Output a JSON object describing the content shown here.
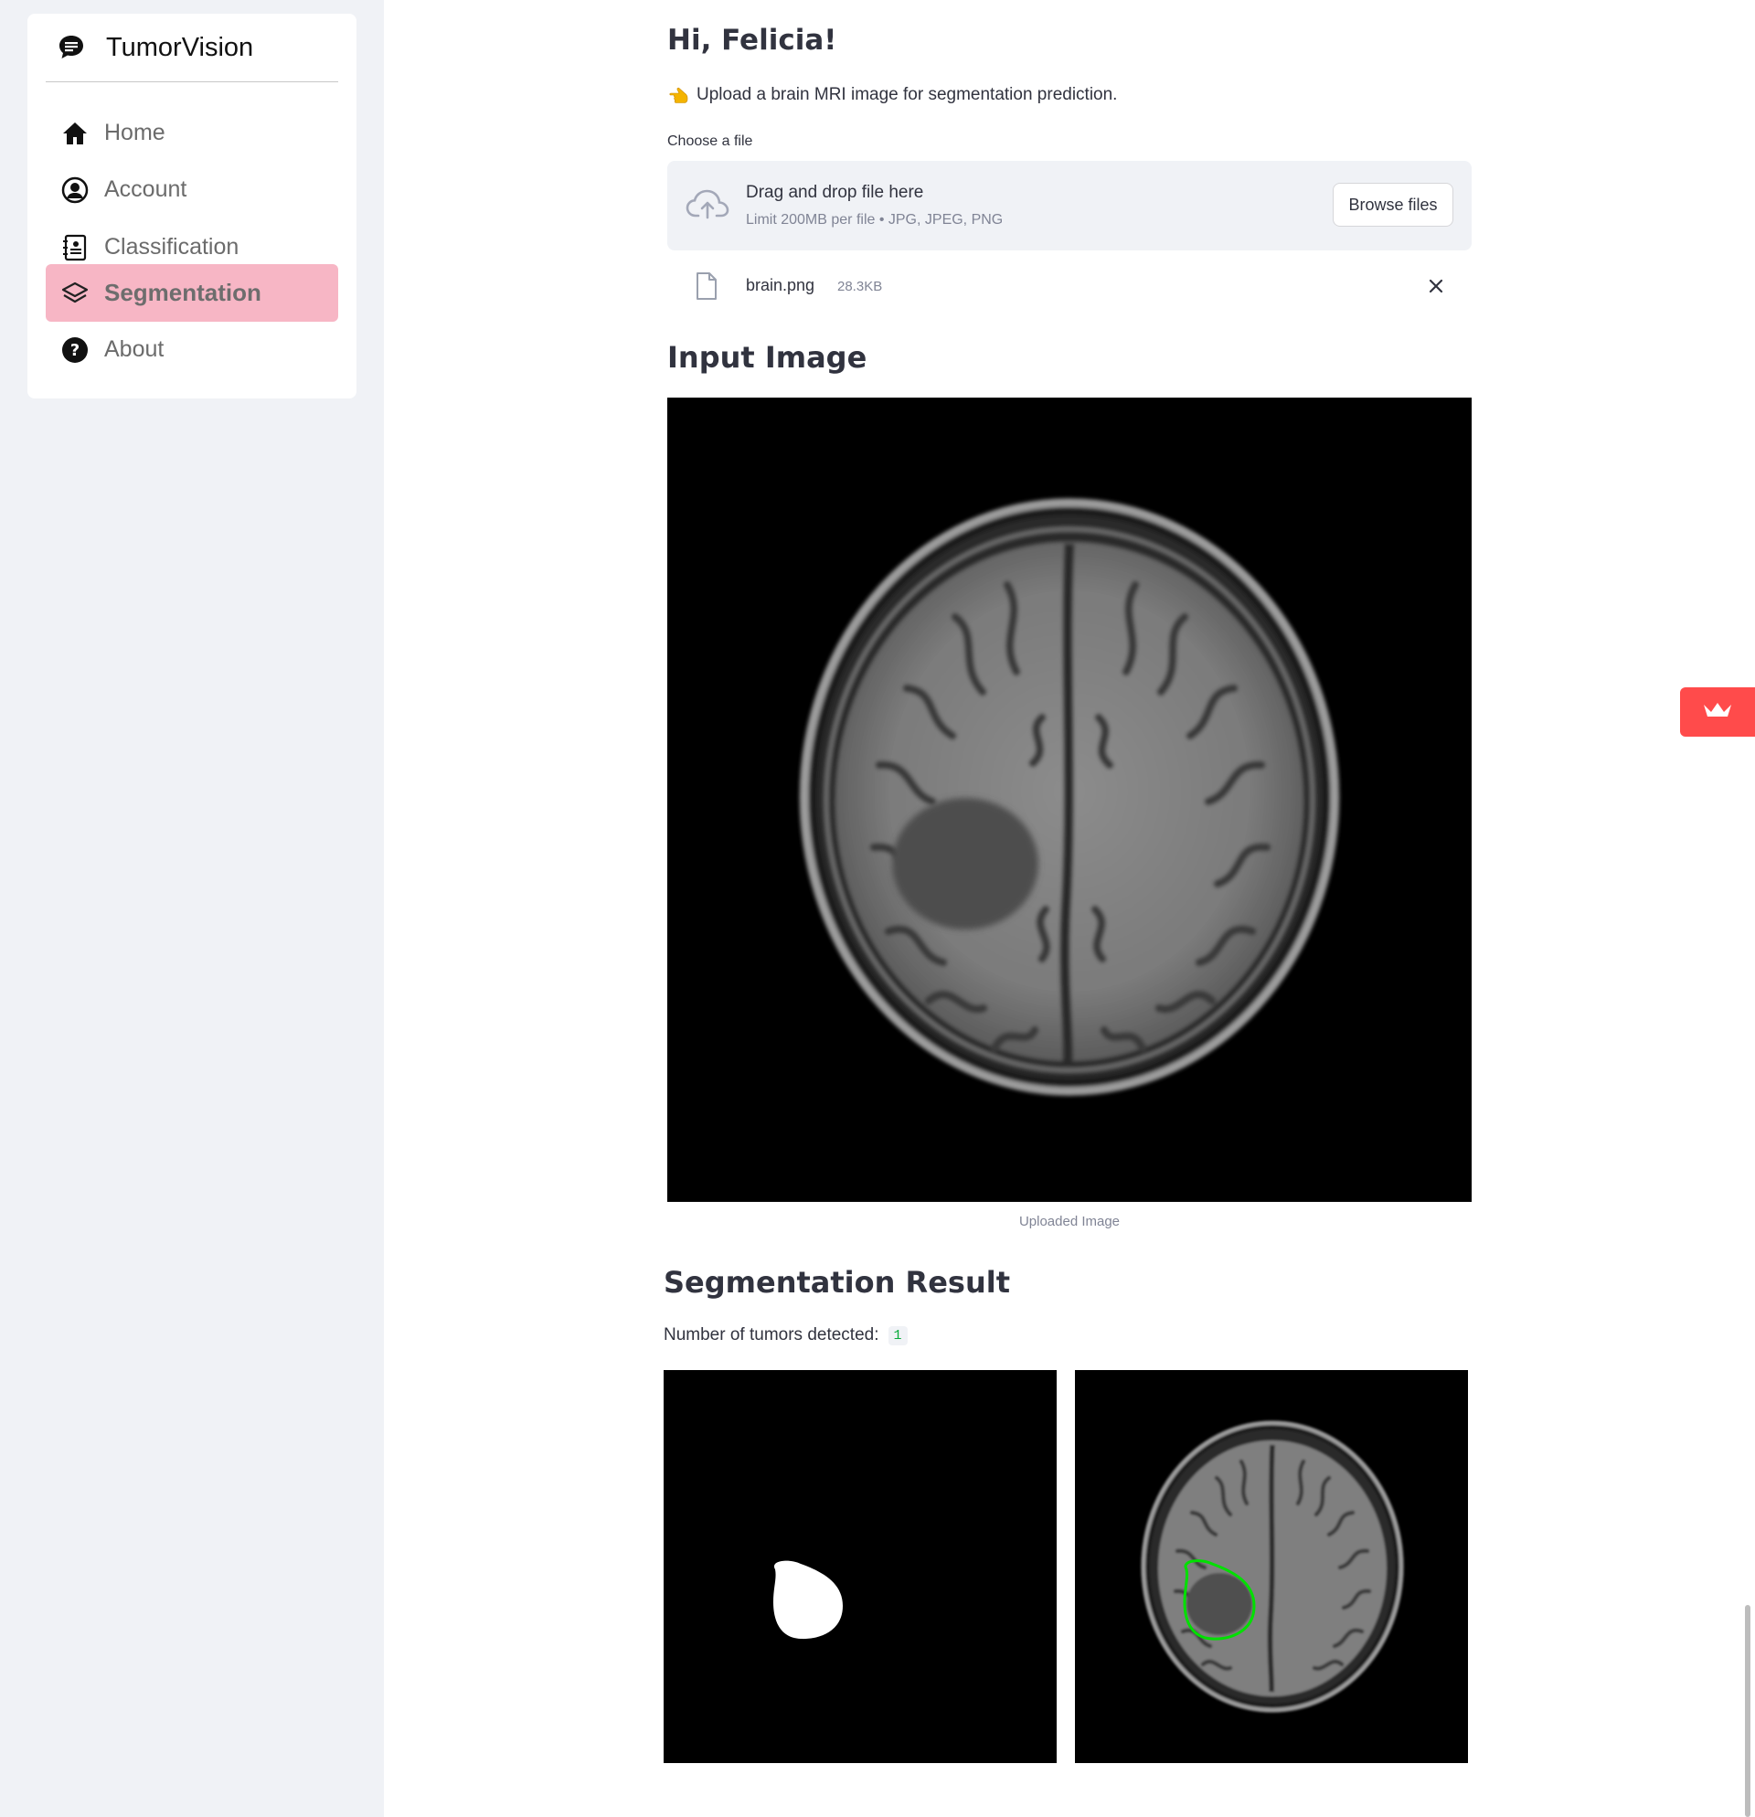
{
  "app": {
    "brand": "TumorVision"
  },
  "sidebar": {
    "items": [
      {
        "label": "Home",
        "icon": "house-icon"
      },
      {
        "label": "Account",
        "icon": "user-circle-icon"
      },
      {
        "label": "Classification",
        "icon": "contact-list-icon"
      },
      {
        "label": "Segmentation",
        "icon": "layers-icon",
        "active": true
      },
      {
        "label": "About",
        "icon": "question-circle-icon"
      }
    ]
  },
  "main": {
    "greeting": "Hi, Felicia!",
    "instruction": "Upload a brain MRI image for segmentation prediction.",
    "uploader": {
      "label": "Choose a file",
      "drop_title": "Drag and drop file here",
      "limit": "Limit 200MB per file • JPG, JPEG, PNG",
      "browse_label": "Browse files"
    },
    "file": {
      "name": "brain.png",
      "size": "28.3KB"
    },
    "input_heading": "Input Image",
    "input_caption": "Uploaded Image",
    "result_heading": "Segmentation Result",
    "tumor_label": "Number of tumors detected:",
    "tumor_count": "1"
  },
  "colors": {
    "active_nav": "#f7b6c5",
    "accent_red": "#ff4b4b",
    "count_green": "#09ab3b",
    "contour_green": "#00e000",
    "sidebar_bg": "#f0f2f6"
  }
}
